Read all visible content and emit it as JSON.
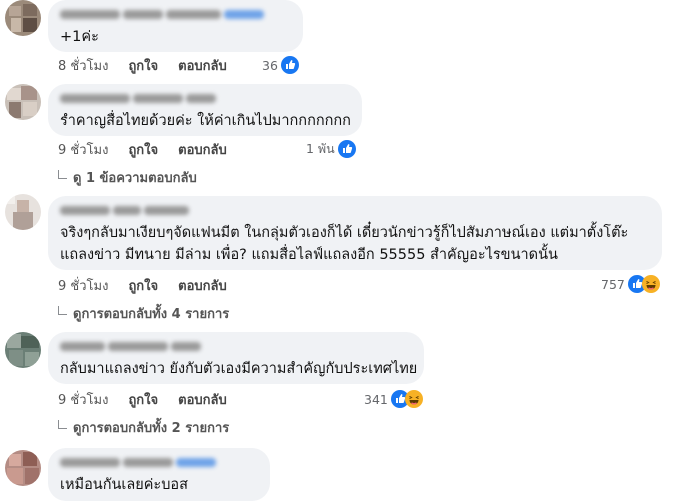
{
  "comments": [
    {
      "text": "+1ค่ะ",
      "time": "8 ชั่วโมง",
      "like_label": "ถูกใจ",
      "reply_label": "ตอบกลับ",
      "reaction_count": "36",
      "reactions": [
        "like-icon"
      ]
    },
    {
      "text": "รำคาญสื่อไทยด้วยค่ะ ให้ค่าเกินไปมากกกกกกก",
      "time": "9 ชั่วโมง",
      "like_label": "ถูกใจ",
      "reply_label": "ตอบกลับ",
      "reaction_count": "1 พัน",
      "reactions": [
        "like-icon"
      ],
      "replies_label": "ดู 1 ข้อความตอบกลับ"
    },
    {
      "text_lines": [
        "จริงๆกลับมาเงียบๆจัดแฟนมีต ในกลุ่มตัวเองก็ได้ เดี๋ยวนักข่าวรู้ก็ไปสัมภาษณ์เอง แต่มาตั้งโต๊ะ",
        "แถลงข่าว มีทนาย มีล่าม เพื่อ? แถมสื่อไลฟ์แถลงอีก 55555 สำคัญอะไรขนาดนั้น"
      ],
      "time": "9 ชั่วโมง",
      "like_label": "ถูกใจ",
      "reply_label": "ตอบกลับ",
      "reaction_count": "757",
      "reactions": [
        "like-icon",
        "haha-icon"
      ],
      "replies_label": "ดูการตอบกลับทั้ง 4 รายการ"
    },
    {
      "text": "กลับมาแถลงข่าว ยังกับตัวเองมีความสำคัญกับประเทศไทย",
      "time": "9 ชั่วโมง",
      "like_label": "ถูกใจ",
      "reply_label": "ตอบกลับ",
      "reaction_count": "341",
      "reactions": [
        "like-icon",
        "haha-icon"
      ],
      "replies_label": "ดูการตอบกลับทั้ง 2 รายการ"
    },
    {
      "text": "เหมือนกันเลยค่ะบอส"
    }
  ],
  "colors": {
    "bubble": "#f0f2f5",
    "meta_text": "#65676b",
    "like_blue": "#1877f2",
    "haha_yellow": "#f7b125"
  }
}
